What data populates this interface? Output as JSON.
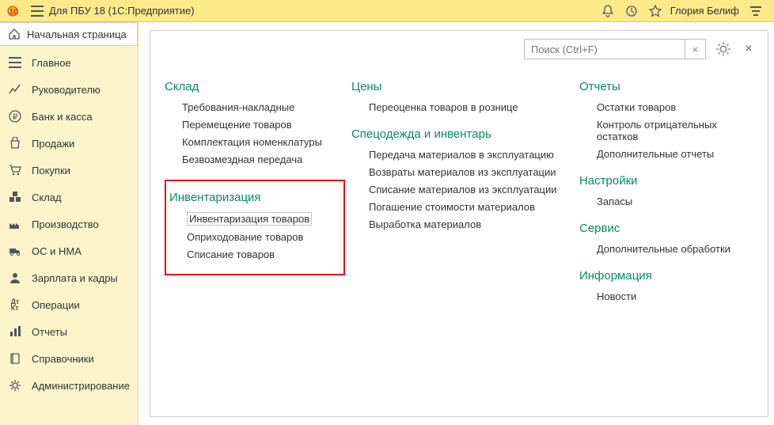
{
  "titlebar": {
    "app_title": "Для ПБУ 18  (1С:Предприятие)",
    "user": "Глория Белиф"
  },
  "home_tab": "Начальная страница",
  "sidebar": {
    "items": [
      {
        "label": "Главное"
      },
      {
        "label": "Руководителю"
      },
      {
        "label": "Банк и касса"
      },
      {
        "label": "Продажи"
      },
      {
        "label": "Покупки"
      },
      {
        "label": "Склад"
      },
      {
        "label": "Производство"
      },
      {
        "label": "ОС и НМА"
      },
      {
        "label": "Зарплата и кадры"
      },
      {
        "label": "Операции"
      },
      {
        "label": "Отчеты"
      },
      {
        "label": "Справочники"
      },
      {
        "label": "Администрирование"
      }
    ]
  },
  "search": {
    "placeholder": "Поиск (Ctrl+F)"
  },
  "col1": {
    "sklad": {
      "title": "Склад",
      "items": [
        "Требования-накладные",
        "Перемещение товаров",
        "Комплектация номенклатуры",
        "Безвозмездная передача"
      ]
    },
    "invent": {
      "title": "Инвентаризация",
      "items": [
        "Инвентаризация товаров",
        "Оприходование товаров",
        "Списание товаров"
      ]
    }
  },
  "col2": {
    "ceny": {
      "title": "Цены",
      "items": [
        "Переоценка товаров в рознице"
      ]
    },
    "spec": {
      "title": "Спецодежда и инвентарь",
      "items": [
        "Передача материалов в эксплуатацию",
        "Возвраты материалов из эксплуатации",
        "Списание материалов из эксплуатации",
        "Погашение стоимости материалов",
        "Выработка материалов"
      ]
    }
  },
  "col3": {
    "otchety": {
      "title": "Отчеты",
      "items": [
        "Остатки товаров",
        "Контроль отрицательных остатков",
        "Дополнительные отчеты"
      ]
    },
    "nastroiki": {
      "title": "Настройки",
      "items": [
        "Запасы"
      ]
    },
    "servis": {
      "title": "Сервис",
      "items": [
        "Дополнительные обработки"
      ]
    },
    "info": {
      "title": "Информация",
      "items": [
        "Новости"
      ]
    }
  }
}
